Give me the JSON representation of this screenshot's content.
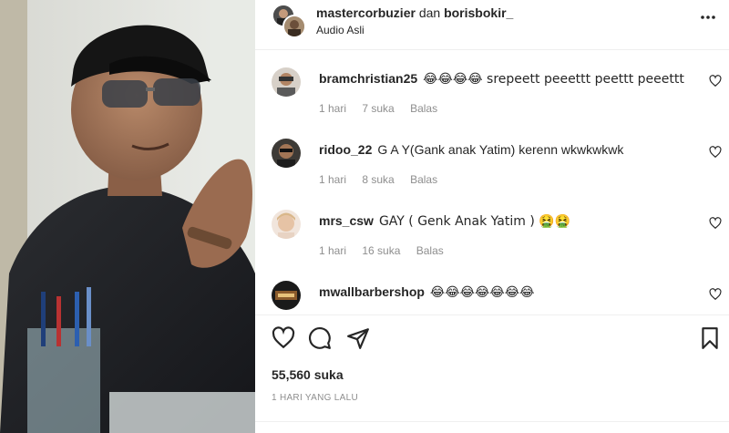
{
  "header": {
    "user1": "mastercorbuzier",
    "joiner": "dan",
    "user2": "borisbokir_",
    "audio": "Audio Asli"
  },
  "comments": [
    {
      "username": "bramchristian25",
      "text": "😂😂😂😂 srepeett peeettt peettt peeettt",
      "time": "1 hari",
      "likes": "7 suka",
      "reply": "Balas"
    },
    {
      "username": "ridoo_22",
      "text": "G A Y(Gank anak Yatim) kerenn wkwkwkwk",
      "time": "1 hari",
      "likes": "8 suka",
      "reply": "Balas"
    },
    {
      "username": "mrs_csw",
      "text": "GAY ( Genk Anak Yatim ) 🤮🤮",
      "time": "1 hari",
      "likes": "16 suka",
      "reply": "Balas"
    },
    {
      "username": "mwallbarbershop",
      "text": "😂😂😂😂😂😂😂",
      "time": "",
      "likes": "",
      "reply": ""
    }
  ],
  "post": {
    "likes": "55,560 suka",
    "time": "1 HARI YANG LALU"
  },
  "icons": {
    "more": "more-options-icon",
    "heart": "heart-icon",
    "comment": "comment-icon",
    "share": "share-icon",
    "save": "bookmark-icon"
  },
  "colors": {
    "text": "#262626",
    "muted": "#8e8e8e",
    "divider": "#efefef"
  }
}
